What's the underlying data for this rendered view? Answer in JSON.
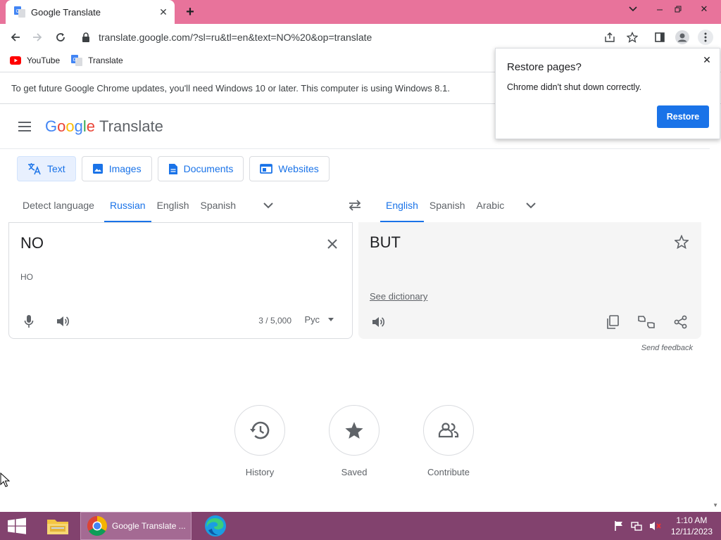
{
  "browser": {
    "tab_title": "Google Translate",
    "url": "translate.google.com/?sl=ru&tl=en&text=NO%20&op=translate",
    "bookmarks": [
      {
        "label": "YouTube",
        "icon": "youtube-icon"
      },
      {
        "label": "Translate",
        "icon": "translate-icon"
      }
    ],
    "infobar": "To get future Google Chrome updates, you'll need Windows 10 or later. This computer is using Windows 8.1."
  },
  "popup": {
    "title": "Restore pages?",
    "message": "Chrome didn't shut down correctly.",
    "button": "Restore"
  },
  "header": {
    "logo_letters": [
      "G",
      "o",
      "o",
      "g",
      "l",
      "e"
    ],
    "product": "Translate"
  },
  "modes": [
    {
      "label": "Text",
      "icon": "translate-icon",
      "active": true
    },
    {
      "label": "Images",
      "icon": "image-icon",
      "active": false
    },
    {
      "label": "Documents",
      "icon": "document-icon",
      "active": false
    },
    {
      "label": "Websites",
      "icon": "website-icon",
      "active": false
    }
  ],
  "source_languages": [
    "Detect language",
    "Russian",
    "English",
    "Spanish"
  ],
  "source_selected": "Russian",
  "target_languages": [
    "English",
    "Spanish",
    "Arabic"
  ],
  "target_selected": "English",
  "source": {
    "text": "NO",
    "transliteration": "НО",
    "counter": "3 / 5,000",
    "keyboard": "Рус"
  },
  "target": {
    "text": "BUT",
    "see_dictionary": "See dictionary",
    "send_feedback": "Send feedback"
  },
  "bottom": {
    "history": "History",
    "saved": "Saved",
    "contribute": "Contribute"
  },
  "taskbar": {
    "chrome_label": "Google Translate ...",
    "time": "1:10 AM",
    "date": "12/11/2023"
  },
  "colors": {
    "titlebar": "#e8739b",
    "accent": "#1a73e8",
    "taskbar": "#82426e"
  }
}
